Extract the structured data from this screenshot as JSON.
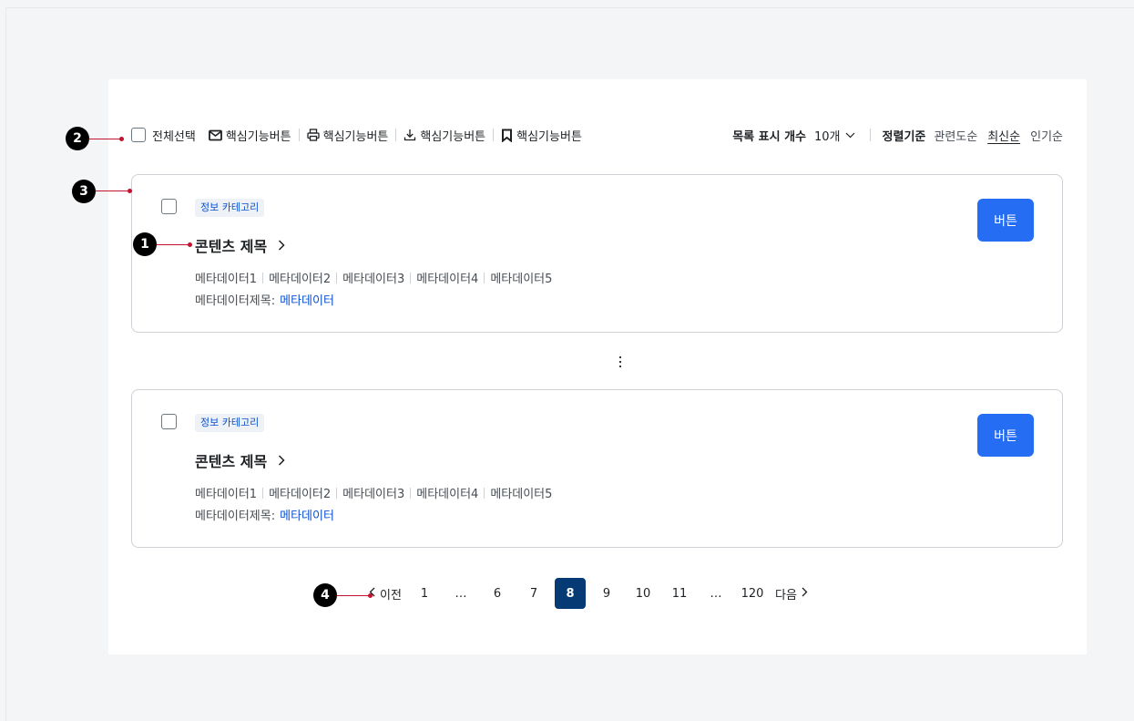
{
  "toolbar": {
    "select_all_label": "전체선택",
    "actions": [
      {
        "icon": "mail-icon",
        "label": "핵심기능버튼"
      },
      {
        "icon": "printer-icon",
        "label": "핵심기능버튼"
      },
      {
        "icon": "download-icon",
        "label": "핵심기능버튼"
      },
      {
        "icon": "bookmark-icon",
        "label": "핵심기능버튼"
      }
    ],
    "display_count_label": "목록 표시 개수",
    "display_count_value": "10개",
    "sort_label": "정렬기준",
    "sort_options": [
      "관련도순",
      "최신순",
      "인기순"
    ],
    "sort_active": "최신순"
  },
  "cards": [
    {
      "category": "정보 카테고리",
      "title": "콘텐츠 제목",
      "metadata": [
        "메타데이터1",
        "메타데이터2",
        "메타데이터3",
        "메타데이터4",
        "메타데이터5"
      ],
      "meta_title": "메타데이터제목:",
      "meta_value": "메타데이터",
      "button": "버튼"
    },
    {
      "category": "정보 카테고리",
      "title": "콘텐츠 제목",
      "metadata": [
        "메타데이터1",
        "메타데이터2",
        "메타데이터3",
        "메타데이터4",
        "메타데이터5"
      ],
      "meta_title": "메타데이터제목:",
      "meta_value": "메타데이터",
      "button": "버튼"
    }
  ],
  "pagination": {
    "prev": "이전",
    "next": "다음",
    "pages": [
      "1",
      "…",
      "6",
      "7",
      "8",
      "9",
      "10",
      "11",
      "…",
      "120"
    ],
    "current": "8"
  },
  "markers": [
    "1",
    "2",
    "3",
    "4"
  ],
  "colors": {
    "primary": "#256ef4",
    "pager_active": "#063a74",
    "link": "#0b50d0",
    "annotation": "#c4122f"
  }
}
